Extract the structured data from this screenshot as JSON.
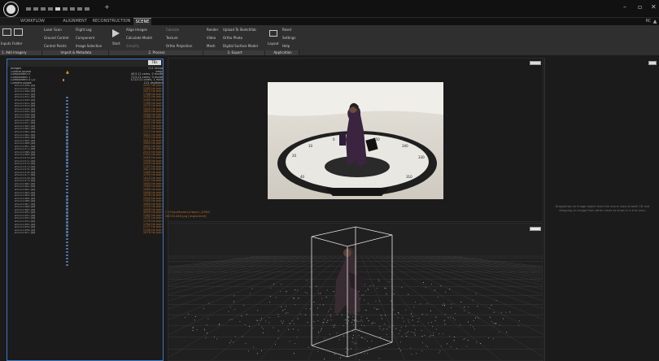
{
  "tabs": {
    "workflow": "WORKFLOW",
    "alignment": "ALIGNMENT",
    "reconstruction": "RECONSTRUCTION",
    "scene": "SCENE"
  },
  "ribbon": {
    "inputs": "Inputs",
    "folder": "Folder",
    "laser_scan": "Laser Scan",
    "ground_control": "Ground Control",
    "control_points": "Control Points",
    "flight_log": "Flight Log",
    "component": "Component",
    "image_selection": "Image Selection",
    "start": "Start",
    "align_images": "Align Images",
    "calculate_model": "Calculate Model",
    "simplify": "Simplify",
    "colorize": "Colorize",
    "texture": "Texture",
    "ortho_projection": "Ortho Projection",
    "render": "Render",
    "video": "Video",
    "mesh": "Mesh",
    "upload_sketchfab": "Upload To Sketchfab",
    "ortho_photo": "Ortho Photo",
    "digital_surface_model": "Digital Surface Model",
    "layout": "Layout",
    "reset": "Reset",
    "settings": "Settings",
    "help": "Help",
    "groups": {
      "add_imagery": "1. Add imagery",
      "import_metadata": "Import & Metadata",
      "process": "2. Process",
      "export": "3. Export",
      "application": "Application"
    },
    "rc_label": "RC"
  },
  "left_panel": {
    "button": "TBs",
    "rows": [
      {
        "name": "Images",
        "value": "111 images"
      },
      {
        "name": "Control points",
        "value": "empty"
      },
      {
        "name": "Component 0",
        "value": "40/111 cams, 0 models"
      },
      {
        "name": "Component 1",
        "value": "71/111 cams, 0 models"
      },
      {
        "name": "Component 0 (2)",
        "value": "111/111 cams, 1 model"
      },
      {
        "name": "Camera poses",
        "value": "111 registered"
      }
    ],
    "images": [
      [
        "DSC01446.jpg",
        "1057 tie points"
      ],
      [
        "DSC01447.jpg",
        "1283 tie points"
      ],
      [
        "DSC01448.jpg",
        "1613 tie points"
      ],
      [
        "DSC01450.jpg",
        "1788 tie points"
      ],
      [
        "DSC01451.jpg",
        "1032 tie points"
      ],
      [
        "DSC01449.jpg",
        "1080 tie points"
      ],
      [
        "DSC01452.jpg",
        "1789 tie points"
      ],
      [
        "DSC01453.jpg",
        "1575 tie points"
      ],
      [
        "DSC01454.jpg",
        "1402 tie points"
      ],
      [
        "DSC01455.jpg",
        "1603 tie points"
      ],
      [
        "DSC01456.jpg",
        "1584 tie points"
      ],
      [
        "DSC01458.jpg",
        "1568 tie points"
      ],
      [
        "DSC01459.jpg",
        "1537 tie points"
      ],
      [
        "DSC01457.jpg",
        "1652 tie points"
      ],
      [
        "DSC01463.jpg",
        "1271 tie points"
      ],
      [
        "DSC01460.jpg",
        "1271 tie points"
      ],
      [
        "DSC01461.jpg",
        "1210 tie points"
      ],
      [
        "DSC01462.jpg",
        "1821 tie points"
      ],
      [
        "DSC01464.jpg",
        "1752 tie points"
      ],
      [
        "DSC01465.jpg",
        "1812 tie points"
      ],
      [
        "DSC01466.jpg",
        "1663 tie points"
      ],
      [
        "DSC01467.jpg",
        "1801 tie points"
      ],
      [
        "DSC01471.jpg",
        "2058 tie points"
      ],
      [
        "DSC01468.jpg",
        "2015 tie points"
      ],
      [
        "DSC01469.jpg",
        "2102 tie points"
      ],
      [
        "DSC01470.jpg",
        "1849 tie points"
      ],
      [
        "DSC01472.jpg",
        "1956 tie points"
      ],
      [
        "DSC01475.jpg",
        "1493 tie points"
      ],
      [
        "DSC01473.jpg",
        "1747 tie points"
      ],
      [
        "DSC01474.jpg",
        "1613 tie points"
      ],
      [
        "DSC01476.jpg",
        "1389 tie points"
      ],
      [
        "DSC01477.jpg",
        "1550 tie points"
      ],
      [
        "DSC01478.jpg",
        "1415 tie points"
      ],
      [
        "DSC01479.jpg",
        "1537 tie points"
      ],
      [
        "DSC01480.jpg",
        "1693 tie points"
      ],
      [
        "DSC01481.jpg",
        "1564 tie points"
      ],
      [
        "DSC01482.jpg",
        "1680 tie points"
      ],
      [
        "DSC01483.jpg",
        "1806 tie points"
      ],
      [
        "DSC01485.jpg",
        "1678 tie points"
      ],
      [
        "DSC01484.jpg",
        "1554 tie points"
      ],
      [
        "DSC01486.jpg",
        "1305 tie points"
      ],
      [
        "DSC01487.jpg",
        "1663 tie points"
      ],
      [
        "DSC01488.jpg",
        "1224 tie points"
      ],
      [
        "DSC01489.jpg",
        "1659 tie points"
      ],
      [
        "DSC01490.jpg",
        "1659 tie points"
      ],
      [
        "DSC01491.jpg",
        "1382 tie points"
      ],
      [
        "DSC01492.jpg",
        "1432 tie points"
      ],
      [
        "DSC01493.jpg",
        "1376 tie points"
      ],
      [
        "DSC01494.jpg",
        "1764 tie points"
      ],
      [
        "DSC01495.jpg",
        "2137 tie points"
      ],
      [
        "DSC01496.jpg",
        "2256 tie points"
      ],
      [
        "DSC01497.jpg",
        "1876 tie points"
      ]
    ]
  },
  "overlay": {
    "line1": "C:\\Tmp\\Models\\Object_2\\PKG",
    "line2": "DSC01446.jpg [registered]"
  },
  "side_panel": {
    "hint": "Drag&drop an image object from the scene view at both 2D and dropping an image from other views to show it in this area."
  }
}
